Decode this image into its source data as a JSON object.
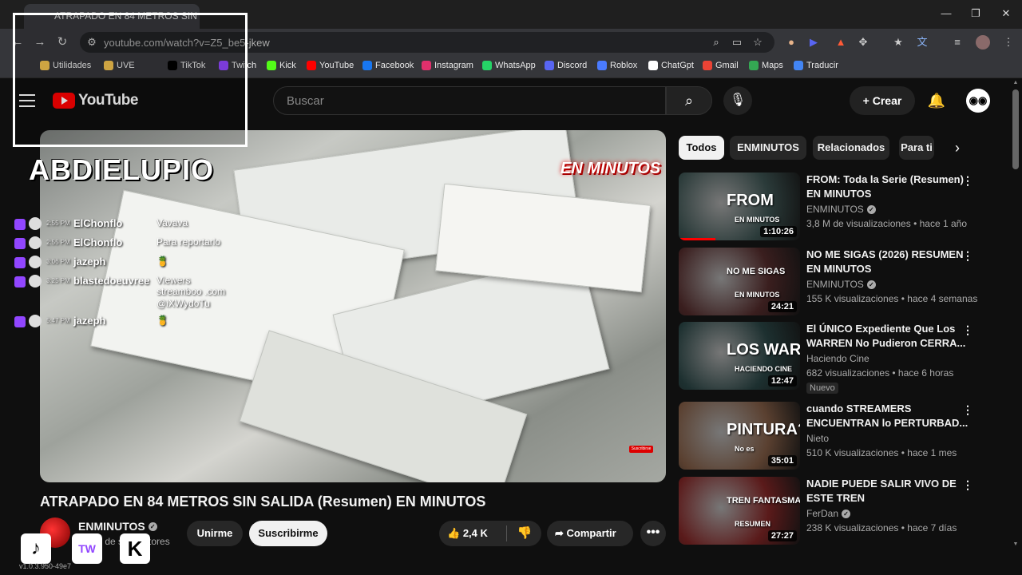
{
  "browser": {
    "tab_title": "ATRAPADO EN 84 METROS SIN",
    "url": "youtube.com/watch?v=Z5_be5-jkew",
    "window_controls": [
      "—",
      "❐",
      "✕"
    ]
  },
  "bookmarks": [
    {
      "label": "Utilidades",
      "icon": "folder-icon",
      "color": "#f2c14e"
    },
    {
      "label": "UVE",
      "icon": "folder-icon",
      "color": "#f2c14e"
    },
    {
      "label": "TikTok",
      "icon": "tiktok-icon",
      "color": "#000000"
    },
    {
      "label": "Twitch",
      "icon": "twitch-icon",
      "color": "#9146ff"
    },
    {
      "label": "Kick",
      "icon": "kick-icon",
      "color": "#53fc18"
    },
    {
      "label": "YouTube",
      "icon": "youtube-icon",
      "color": "#ff0000"
    },
    {
      "label": "Facebook",
      "icon": "facebook-icon",
      "color": "#1877f2"
    },
    {
      "label": "Instagram",
      "icon": "instagram-icon",
      "color": "#e1306c"
    },
    {
      "label": "WhatsApp",
      "icon": "whatsapp-icon",
      "color": "#25d366"
    },
    {
      "label": "Discord",
      "icon": "discord-icon",
      "color": "#5865f2"
    },
    {
      "label": "Roblox",
      "icon": "roblox-icon",
      "color": "#4a7bff"
    },
    {
      "label": "ChatGpt",
      "icon": "chatgpt-icon",
      "color": "#ffffff"
    },
    {
      "label": "Gmail",
      "icon": "gmail-icon",
      "color": "#ea4335"
    },
    {
      "label": "Maps",
      "icon": "maps-icon",
      "color": "#34a853"
    },
    {
      "label": "Traducir",
      "icon": "translate-icon",
      "color": "#4285f4"
    }
  ],
  "youtube": {
    "logo_text": "YouTube",
    "search_placeholder": "Buscar",
    "create_label": "Crear",
    "video": {
      "title": "ATRAPADO EN 84 METROS SIN SALIDA (Resumen) EN MINUTOS",
      "overlay_logo": "EN MINUTOS",
      "subscribe_mini": "Suscribirse",
      "channel": "ENMINUTOS",
      "subscribers": "3,1 M de suscriptores",
      "unsubscribe": "Unirme",
      "subscribe": "Suscribirme",
      "likes": "2,4 K",
      "share": "Compartir",
      "more": "•••"
    },
    "chips": [
      "Todos",
      "ENMINUTOS",
      "Relacionados",
      "Para ti"
    ],
    "recommendations": [
      {
        "title": "FROM: Toda la Serie (Resumen) EN MINUTOS",
        "channel": "ENMINUTOS",
        "verified": true,
        "meta": "3,8 M de visualizaciones • hace 1 año",
        "duration": "1:10:26",
        "thumb_text": "FROM",
        "thumb_sub": "EN MINUTOS",
        "badge": "",
        "progress": 0.3,
        "bg": "#2b3b3a"
      },
      {
        "title": "NO ME SIGAS (2026) RESUMEN EN MINUTOS",
        "channel": "ENMINUTOS",
        "verified": true,
        "meta": "155 K visualizaciones • hace 4 semanas",
        "duration": "24:21",
        "thumb_text": "NO ME SIGAS",
        "thumb_sub": "EN MINUTOS",
        "badge": "",
        "progress": 0,
        "bg": "#3a1e1e"
      },
      {
        "title": "El ÚNICO Expediente Que Los WARREN No Pudieron CERRA...",
        "channel": "Haciendo Cine",
        "verified": false,
        "meta": "682 visualizaciones • hace 6 horas",
        "duration": "12:47",
        "thumb_text": "LOS WARREN",
        "thumb_sub": "HACIENDO CINE",
        "badge": "Nuevo",
        "progress": 0,
        "bg": "#1d3030"
      },
      {
        "title": "cuando STREAMERS ENCUENTRAN lo PERTURBAD...",
        "channel": "Nieto",
        "verified": false,
        "meta": "510 K visualizaciones • hace 1 mes",
        "duration": "35:01",
        "thumb_text": "PINTURA?",
        "thumb_sub": "No es",
        "badge": "",
        "progress": 0,
        "bg": "#5a4030"
      },
      {
        "title": "NADIE PUEDE SALIR VIVO DE ESTE TREN",
        "channel": "FerDan",
        "verified": true,
        "meta": "238 K visualizaciones • hace 7 días",
        "duration": "27:27",
        "thumb_text": "TREN FANTASMA TURBIO",
        "thumb_sub": "RESUMEN",
        "badge": "",
        "progress": 0,
        "bg": "#5a1a1a"
      }
    ]
  },
  "overlay": {
    "brand": "ABDIELUPIO",
    "chat": [
      {
        "time": "2:55 PM",
        "user": "ElChonflo",
        "message": "Vavava"
      },
      {
        "time": "2:55 PM",
        "user": "ElChonflo",
        "message": "Para reportarlo"
      },
      {
        "time": "3:06 PM",
        "user": "jazeph",
        "message": "🍍"
      },
      {
        "time": "3:25 PM",
        "user": "blastedoeuvree",
        "message": "Viewers"
      },
      {
        "time": "5:47 PM",
        "user": "jazeph",
        "message": "🍍"
      }
    ],
    "chat_extra_lines": [
      "streamboo .com",
      "@iXWydoTu"
    ],
    "version": "v1.0.3.950-49e7"
  }
}
